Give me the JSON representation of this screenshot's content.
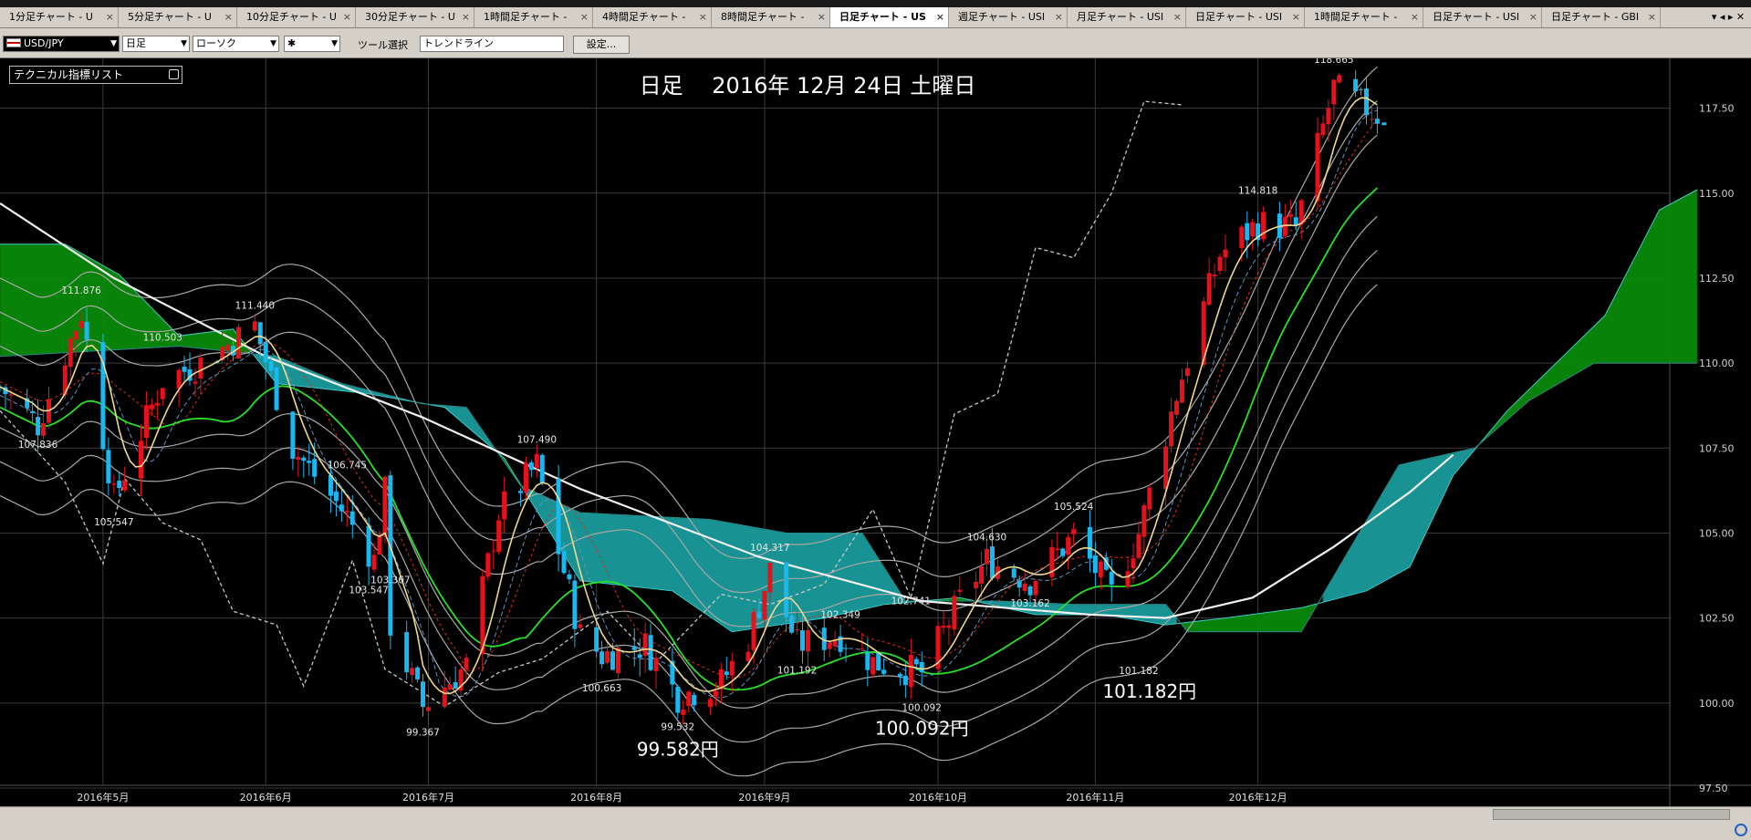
{
  "tabs": [
    {
      "label": "1分足チャート - U"
    },
    {
      "label": "5分足チャート - U"
    },
    {
      "label": "10分足チャート - U"
    },
    {
      "label": "30分足チャート - U"
    },
    {
      "label": "1時間足チャート -"
    },
    {
      "label": "4時間足チャート -"
    },
    {
      "label": "8時間足チャート -"
    },
    {
      "label": "日足チャート - US",
      "active": true
    },
    {
      "label": "週足チャート - USI"
    },
    {
      "label": "月足チャート - USI"
    },
    {
      "label": "日足チャート - USI"
    },
    {
      "label": "1時間足チャート -"
    },
    {
      "label": "日足チャート - USI"
    },
    {
      "label": "日足チャート - GBI"
    }
  ],
  "toolbar": {
    "symbol": "USD/JPY",
    "timeframe": "日足",
    "chart_type": "ローソク",
    "line_style": "✱",
    "tool_label": "ツール選択",
    "tool_value": "トレンドライン",
    "settings_button": "設定..."
  },
  "indicator_list": "テクニカル指標リスト",
  "colors": {
    "bull": "#e8101a",
    "bear": "#1ab8f0",
    "cloud_bear": "#1a9a9a",
    "cloud_bull": "#0a8a0a",
    "tenkan": "#f0d890",
    "kijun": "#28e028",
    "ma200": "#f0f0f0",
    "bands": "#a8a8a8",
    "chikou": "#c8c8c8",
    "grid": "#3a3a3a"
  },
  "chart_data": {
    "type": "candlestick",
    "title": "日足　 2016年 12月 24日 土曜日",
    "instrument": "USD/JPY",
    "ylim": [
      97.5,
      118.75
    ],
    "yticks": [
      "97.50",
      "100.00",
      "102.50",
      "105.00",
      "107.50",
      "110.00",
      "112.50",
      "115.00",
      "117.50"
    ],
    "xticks": [
      "2016年5月",
      "2016年6月",
      "2016年7月",
      "2016年8月",
      "2016年9月",
      "2016年10月",
      "2016年11月",
      "2016年12月"
    ],
    "grid": true,
    "indicators": [
      "ichimoku_cloud",
      "bollinger_bands",
      "moving_averages",
      "chikou_span"
    ],
    "annotations": [
      {
        "text": "118.665円",
        "value": 118.665
      },
      {
        "text": "99.582円",
        "value": 99.532
      },
      {
        "text": "100.092円",
        "value": 100.092
      },
      {
        "text": "101.182円",
        "value": 101.182
      }
    ],
    "swing_labels": [
      {
        "text": "107.836",
        "value": 107.836,
        "date": "2016-04-20"
      },
      {
        "text": "111.876",
        "value": 111.876,
        "date": "2016-04-28"
      },
      {
        "text": "105.547",
        "value": 105.547,
        "date": "2016-05-04"
      },
      {
        "text": "110.503",
        "value": 110.503,
        "date": "2016-05-13"
      },
      {
        "text": "111.440",
        "value": 111.44,
        "date": "2016-05-30"
      },
      {
        "text": "106.745",
        "value": 106.745,
        "date": "2016-06-16"
      },
      {
        "text": "103.547",
        "value": 103.547,
        "date": "2016-06-20"
      },
      {
        "text": "103.367",
        "value": 103.367,
        "date": "2016-06-24"
      },
      {
        "text": "99.367",
        "value": 99.367,
        "date": "2016-06-30"
      },
      {
        "text": "107.490",
        "value": 107.49,
        "date": "2016-07-21"
      },
      {
        "text": "100.663",
        "value": 100.663,
        "date": "2016-08-02"
      },
      {
        "text": "99.532",
        "value": 99.532,
        "date": "2016-08-16"
      },
      {
        "text": "104.317",
        "value": 104.317,
        "date": "2016-09-02"
      },
      {
        "text": "101.192",
        "value": 101.192,
        "date": "2016-09-07"
      },
      {
        "text": "102.349",
        "value": 102.349,
        "date": "2016-09-15"
      },
      {
        "text": "102.741",
        "value": 102.741,
        "date": "2016-09-28"
      },
      {
        "text": "100.092",
        "value": 100.092,
        "date": "2016-09-30"
      },
      {
        "text": "104.630",
        "value": 104.63,
        "date": "2016-10-12"
      },
      {
        "text": "103.162",
        "value": 103.162,
        "date": "2016-10-20"
      },
      {
        "text": "105.524",
        "value": 105.524,
        "date": "2016-10-28"
      },
      {
        "text": "101.182",
        "value": 101.182,
        "date": "2016-11-09"
      },
      {
        "text": "114.818",
        "value": 114.818,
        "date": "2016-12-01"
      },
      {
        "text": "118.665",
        "value": 118.665,
        "date": "2016-12-15"
      }
    ],
    "price_anchors": [
      {
        "date": "2016-04-13",
        "value": 109.3
      },
      {
        "date": "2016-04-20",
        "value": 108.2
      },
      {
        "date": "2016-04-28",
        "value": 111.5
      },
      {
        "date": "2016-05-04",
        "value": 106.0
      },
      {
        "date": "2016-05-13",
        "value": 109.5
      },
      {
        "date": "2016-05-20",
        "value": 110.0
      },
      {
        "date": "2016-05-30",
        "value": 111.1
      },
      {
        "date": "2016-06-06",
        "value": 107.5
      },
      {
        "date": "2016-06-16",
        "value": 105.5
      },
      {
        "date": "2016-06-21",
        "value": 104.2
      },
      {
        "date": "2016-06-23",
        "value": 106.2
      },
      {
        "date": "2016-06-24",
        "value": 102.3
      },
      {
        "date": "2016-06-30",
        "value": 99.9
      },
      {
        "date": "2016-07-08",
        "value": 101.1
      },
      {
        "date": "2016-07-14",
        "value": 105.6
      },
      {
        "date": "2016-07-21",
        "value": 107.0
      },
      {
        "date": "2016-07-29",
        "value": 102.0
      },
      {
        "date": "2016-08-02",
        "value": 101.4
      },
      {
        "date": "2016-08-10",
        "value": 101.7
      },
      {
        "date": "2016-08-16",
        "value": 100.2
      },
      {
        "date": "2016-08-24",
        "value": 100.6
      },
      {
        "date": "2016-08-29",
        "value": 101.9
      },
      {
        "date": "2016-09-02",
        "value": 103.9
      },
      {
        "date": "2016-09-07",
        "value": 101.7
      },
      {
        "date": "2016-09-15",
        "value": 102.0
      },
      {
        "date": "2016-09-21",
        "value": 101.2
      },
      {
        "date": "2016-09-30",
        "value": 100.9
      },
      {
        "date": "2016-10-07",
        "value": 103.0
      },
      {
        "date": "2016-10-12",
        "value": 104.2
      },
      {
        "date": "2016-10-20",
        "value": 103.6
      },
      {
        "date": "2016-10-28",
        "value": 104.9
      },
      {
        "date": "2016-11-04",
        "value": 103.2
      },
      {
        "date": "2016-11-09",
        "value": 105.0
      },
      {
        "date": "2016-11-16",
        "value": 109.1
      },
      {
        "date": "2016-11-24",
        "value": 113.2
      },
      {
        "date": "2016-12-01",
        "value": 114.1
      },
      {
        "date": "2016-12-08",
        "value": 114.0
      },
      {
        "date": "2016-12-15",
        "value": 118.1
      },
      {
        "date": "2016-12-23",
        "value": 117.3
      }
    ],
    "cloud_span_a": [
      {
        "date": "2016-04-13",
        "value": 113.5
      },
      {
        "date": "2016-04-25",
        "value": 113.5
      },
      {
        "date": "2016-05-05",
        "value": 112.6
      },
      {
        "date": "2016-05-16",
        "value": 110.8
      },
      {
        "date": "2016-05-26",
        "value": 111.0
      },
      {
        "date": "2016-06-03",
        "value": 109.4
      },
      {
        "date": "2016-06-20",
        "value": 109.1
      },
      {
        "date": "2016-07-04",
        "value": 108.7
      },
      {
        "date": "2016-07-15",
        "value": 107.2
      },
      {
        "date": "2016-07-29",
        "value": 103.6
      },
      {
        "date": "2016-08-15",
        "value": 103.3
      },
      {
        "date": "2016-08-26",
        "value": 102.1
      },
      {
        "date": "2016-09-12",
        "value": 102.5
      },
      {
        "date": "2016-09-23",
        "value": 102.9
      },
      {
        "date": "2016-10-07",
        "value": 103.1
      },
      {
        "date": "2016-10-21",
        "value": 102.6
      },
      {
        "date": "2016-11-03",
        "value": 102.6
      },
      {
        "date": "2016-11-14",
        "value": 102.3
      },
      {
        "date": "2016-11-25",
        "value": 102.5
      },
      {
        "date": "2016-12-09",
        "value": 102.8
      },
      {
        "date": "2016-12-21",
        "value": 103.3
      },
      {
        "date": "2016-12-29",
        "value": 104.0
      },
      {
        "date": "2017-01-06",
        "value": 106.7
      },
      {
        "date": "2017-01-16",
        "value": 108.6
      },
      {
        "date": "2017-01-25",
        "value": 110.0
      },
      {
        "date": "2017-02-03",
        "value": 111.4
      },
      {
        "date": "2017-02-13",
        "value": 114.5
      },
      {
        "date": "2017-02-20",
        "value": 115.1
      }
    ],
    "cloud_span_b": [
      {
        "date": "2016-04-13",
        "value": 110.2
      },
      {
        "date": "2016-05-16",
        "value": 110.5
      },
      {
        "date": "2016-06-03",
        "value": 110.2
      },
      {
        "date": "2016-06-15",
        "value": 109.4
      },
      {
        "date": "2016-06-30",
        "value": 108.8
      },
      {
        "date": "2016-07-08",
        "value": 108.7
      },
      {
        "date": "2016-07-18",
        "value": 106.4
      },
      {
        "date": "2016-07-29",
        "value": 105.6
      },
      {
        "date": "2016-08-22",
        "value": 105.4
      },
      {
        "date": "2016-09-05",
        "value": 105.0
      },
      {
        "date": "2016-09-19",
        "value": 105.0
      },
      {
        "date": "2016-09-27",
        "value": 103.0
      },
      {
        "date": "2016-10-14",
        "value": 103.0
      },
      {
        "date": "2016-10-28",
        "value": 102.9
      },
      {
        "date": "2016-11-14",
        "value": 102.9
      },
      {
        "date": "2016-11-18",
        "value": 102.1
      },
      {
        "date": "2016-12-09",
        "value": 102.1
      },
      {
        "date": "2016-12-27",
        "value": 107.0
      },
      {
        "date": "2017-01-10",
        "value": 107.5
      },
      {
        "date": "2017-01-20",
        "value": 108.9
      },
      {
        "date": "2017-02-01",
        "value": 110.0
      },
      {
        "date": "2017-02-20",
        "value": 110.0
      }
    ],
    "ma200": [
      {
        "date": "2016-04-13",
        "value": 114.7
      },
      {
        "date": "2016-05-04",
        "value": 112.5
      },
      {
        "date": "2016-06-01",
        "value": 110.2
      },
      {
        "date": "2016-06-30",
        "value": 108.4
      },
      {
        "date": "2016-07-29",
        "value": 106.3
      },
      {
        "date": "2016-08-31",
        "value": 104.3
      },
      {
        "date": "2016-09-30",
        "value": 103.0
      },
      {
        "date": "2016-10-31",
        "value": 102.6
      },
      {
        "date": "2016-11-14",
        "value": 102.5
      },
      {
        "date": "2016-11-30",
        "value": 103.1
      },
      {
        "date": "2016-12-15",
        "value": 104.6
      },
      {
        "date": "2016-12-29",
        "value": 106.2
      },
      {
        "date": "2017-01-06",
        "value": 107.3
      }
    ],
    "chikou": [
      {
        "date": "2016-04-13",
        "value": 108.6
      },
      {
        "date": "2016-04-25",
        "value": 106.5
      },
      {
        "date": "2016-05-02",
        "value": 104.1
      },
      {
        "date": "2016-05-06",
        "value": 106.6
      },
      {
        "date": "2016-05-13",
        "value": 105.3
      },
      {
        "date": "2016-05-20",
        "value": 104.8
      },
      {
        "date": "2016-05-26",
        "value": 102.7
      },
      {
        "date": "2016-06-03",
        "value": 102.3
      },
      {
        "date": "2016-06-08",
        "value": 100.5
      },
      {
        "date": "2016-06-17",
        "value": 104.2
      },
      {
        "date": "2016-06-23",
        "value": 101.0
      },
      {
        "date": "2016-07-04",
        "value": 99.9
      },
      {
        "date": "2016-07-14",
        "value": 100.9
      },
      {
        "date": "2016-07-22",
        "value": 101.3
      },
      {
        "date": "2016-08-03",
        "value": 102.7
      },
      {
        "date": "2016-08-12",
        "value": 101.2
      },
      {
        "date": "2016-08-24",
        "value": 103.2
      },
      {
        "date": "2016-09-02",
        "value": 102.9
      },
      {
        "date": "2016-09-12",
        "value": 103.5
      },
      {
        "date": "2016-09-21",
        "value": 105.7
      },
      {
        "date": "2016-09-28",
        "value": 103.1
      },
      {
        "date": "2016-10-06",
        "value": 108.5
      },
      {
        "date": "2016-10-14",
        "value": 109.1
      },
      {
        "date": "2016-10-21",
        "value": 113.4
      },
      {
        "date": "2016-10-28",
        "value": 113.1
      },
      {
        "date": "2016-11-04",
        "value": 115.0
      },
      {
        "date": "2016-11-10",
        "value": 117.7
      },
      {
        "date": "2016-11-17",
        "value": 117.6
      }
    ]
  }
}
